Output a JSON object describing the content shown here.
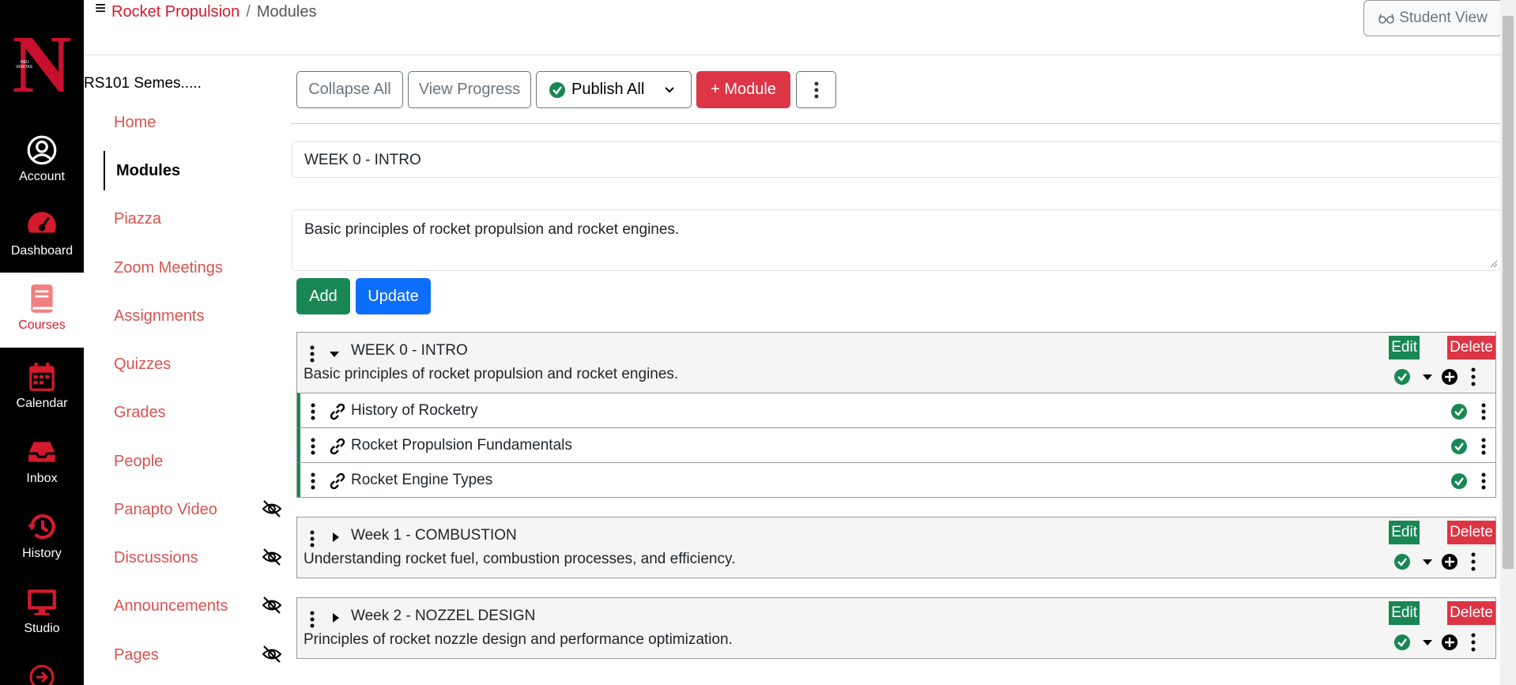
{
  "header": {
    "breadcrumb_course": "Rocket Propulsion",
    "breadcrumb_sep": "/",
    "breadcrumb_page": "Modules",
    "student_view": "Student View"
  },
  "global_nav": [
    {
      "label": "Account",
      "icon": "account-icon"
    },
    {
      "label": "Dashboard",
      "icon": "dashboard-icon"
    },
    {
      "label": "Courses",
      "icon": "book-icon"
    },
    {
      "label": "Calendar",
      "icon": "calendar-icon"
    },
    {
      "label": "Inbox",
      "icon": "inbox-icon"
    },
    {
      "label": "History",
      "icon": "history-icon"
    },
    {
      "label": "Studio",
      "icon": "monitor-icon"
    }
  ],
  "course": {
    "name": "RS101 Semes.....",
    "nav": [
      {
        "label": "Home"
      },
      {
        "label": "Modules"
      },
      {
        "label": "Piazza"
      },
      {
        "label": "Zoom Meetings"
      },
      {
        "label": "Assignments"
      },
      {
        "label": "Quizzes"
      },
      {
        "label": "Grades"
      },
      {
        "label": "People"
      },
      {
        "label": "Panapto Video"
      },
      {
        "label": "Discussions"
      },
      {
        "label": "Announcements"
      },
      {
        "label": "Pages"
      }
    ]
  },
  "toolbar": {
    "collapse_all": "Collapse All",
    "view_progress": "View Progress",
    "publish_all": "Publish All",
    "add_module": "+ Module"
  },
  "form": {
    "module_name": "WEEK 0 - INTRO",
    "module_desc": "Basic principles of rocket propulsion and rocket engines.",
    "add": "Add",
    "update": "Update"
  },
  "modules": [
    {
      "title": "WEEK 0 - INTRO",
      "desc": "Basic principles of rocket propulsion and rocket engines.",
      "edit": "Edit",
      "delete": "Delete",
      "lessons": [
        {
          "title": "History of Rocketry"
        },
        {
          "title": "Rocket Propulsion Fundamentals"
        },
        {
          "title": "Rocket Engine Types"
        }
      ]
    },
    {
      "title": "Week 1 - COMBUSTION",
      "desc": "Understanding rocket fuel, combustion processes, and efficiency.",
      "edit": "Edit",
      "delete": "Delete"
    },
    {
      "title": "Week 2 - NOZZEL DESIGN",
      "desc": "Principles of rocket nozzle design and performance optimization.",
      "edit": "Edit",
      "delete": "Delete"
    }
  ],
  "colors": {
    "brand_red": "#d51a2c",
    "success": "#198754",
    "primary": "#0d6efd",
    "danger": "#dc3545"
  }
}
